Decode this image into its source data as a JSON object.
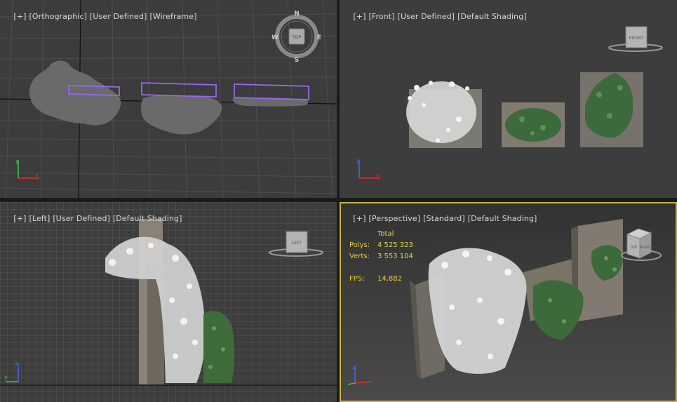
{
  "viewports": {
    "top_left": {
      "label": [
        "[+]",
        "[Orthographic]",
        "[User Defined]",
        "[Wireframe]"
      ],
      "compass": {
        "n": "N",
        "s": "S",
        "e": "E",
        "w": "W",
        "cube": "TOP"
      }
    },
    "top_right": {
      "label": [
        "[+]",
        "[Front]",
        "[User Defined]",
        "[Default Shading]"
      ],
      "cube": "FRONT"
    },
    "bottom_left": {
      "label": [
        "[+]",
        "[Left]",
        "[User Defined]",
        "[Default Shading]"
      ],
      "cube": "LEFT"
    },
    "bottom_right": {
      "label": [
        "[+]",
        "[Perspective]",
        "[Standard]",
        "[Default Shading]"
      ],
      "cube_a": "TOP",
      "cube_b": "RIGHT",
      "stats": {
        "header": "Total",
        "polys_label": "Polys:",
        "polys_value": "4 525 323",
        "verts_label": "Verts:",
        "verts_value": "3 553 104",
        "fps_label": "FPS:",
        "fps_value": "14,882"
      }
    }
  },
  "colors": {
    "viewport_bg": "#3d3d3d",
    "grid_line": "#4f4f4f",
    "selection": "#9966ee",
    "active_border": "#c8b24a",
    "stats_text": "#e8cf4a"
  },
  "axis_labels": {
    "x": "x",
    "y": "y",
    "z": "z"
  }
}
